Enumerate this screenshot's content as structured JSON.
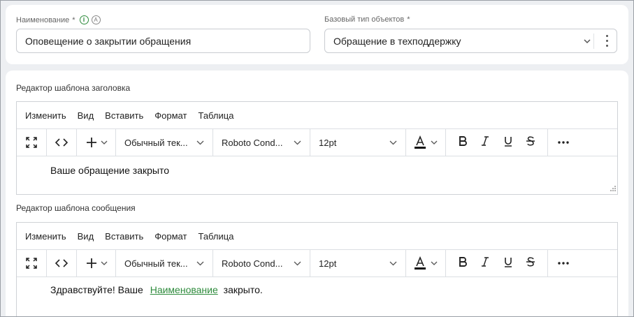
{
  "form": {
    "name_label": "Наименование",
    "name_required": "*",
    "info_icon_glyph": "i",
    "a_icon_glyph": "A",
    "name_value": "Оповещение о закрытии обращения",
    "base_type_label": "Базовый тип объектов",
    "base_type_required": "*",
    "base_type_value": "Обращение в техподдержку"
  },
  "header_editor": {
    "label": "Редактор шаблона заголовка",
    "menu": [
      "Изменить",
      "Вид",
      "Вставить",
      "Формат",
      "Таблица"
    ],
    "style_value": "Обычный тек...",
    "font_value": "Roboto Cond...",
    "size_value": "12pt",
    "content_text": "Ваше обращение закрыто"
  },
  "message_editor": {
    "label": "Редактор шаблона сообщения",
    "menu": [
      "Изменить",
      "Вид",
      "Вставить",
      "Формат",
      "Таблица"
    ],
    "style_value": "Обычный тек...",
    "font_value": "Roboto Cond...",
    "size_value": "12pt",
    "content_prefix": "Здравствуйте! Ваше",
    "content_link": "Наименование",
    "content_suffix": "закрыто."
  },
  "colors": {
    "accent_green": "#2e8b3c",
    "background": "#edeff2",
    "border": "#cfd2d6"
  },
  "icons": {
    "fullscreen": "fullscreen-icon",
    "code": "code-icon",
    "plus": "plus-icon",
    "text_color": "text-color-icon",
    "bold": "bold-icon",
    "italic": "italic-icon",
    "underline": "underline-icon",
    "strikethrough": "strikethrough-icon",
    "more": "more-icon"
  }
}
